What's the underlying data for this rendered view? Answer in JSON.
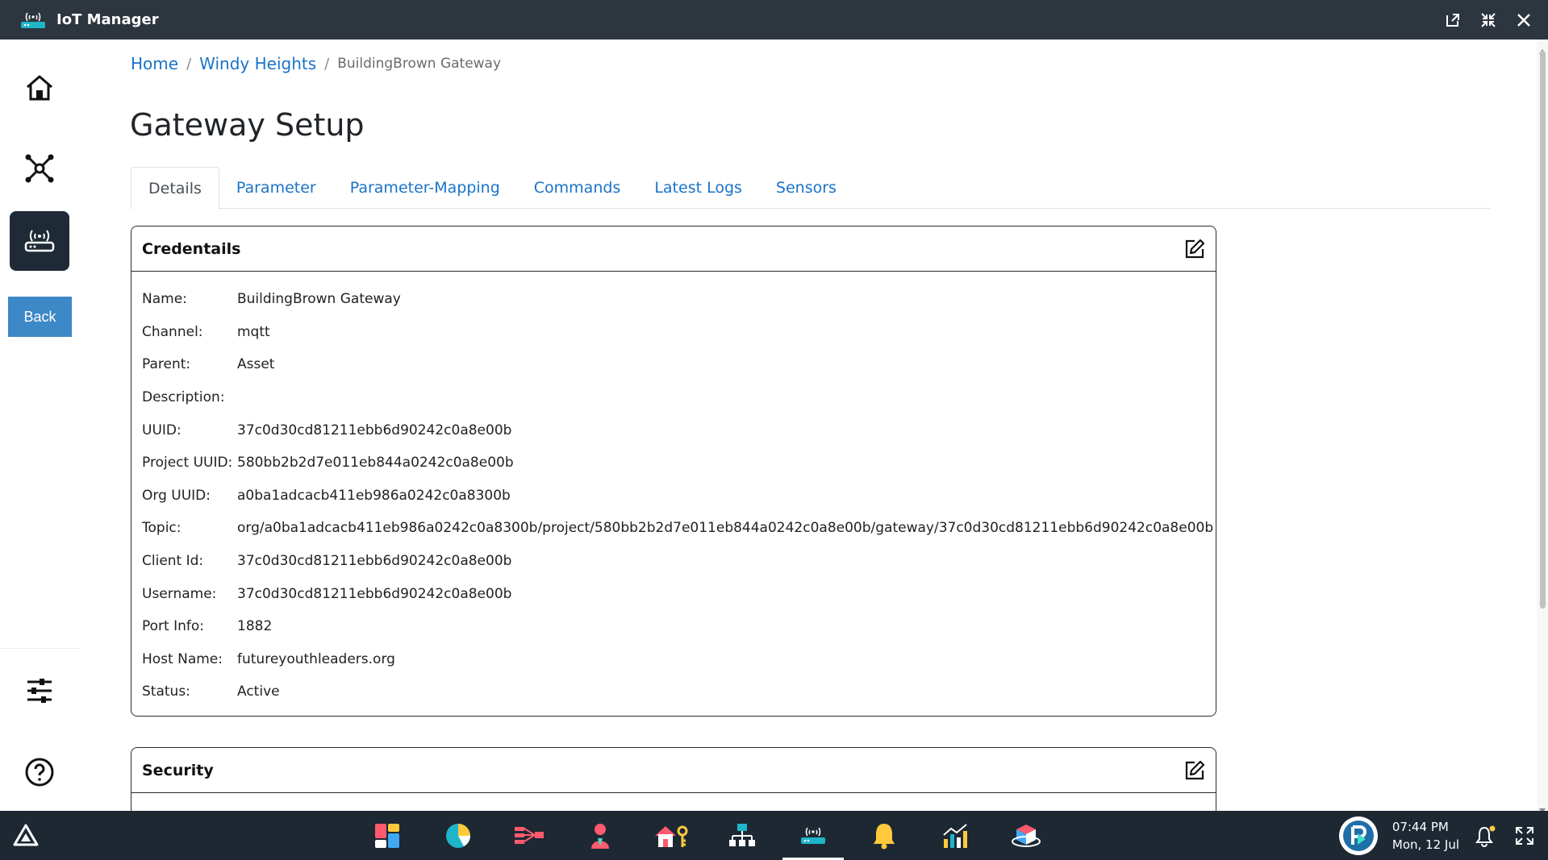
{
  "window": {
    "title": "IoT Manager",
    "controls": [
      "popout-icon",
      "shrink-icon",
      "close-icon"
    ]
  },
  "sidebar": {
    "items": [
      {
        "icon": "home-icon"
      },
      {
        "icon": "network-icon"
      },
      {
        "icon": "gateway-icon",
        "active": true
      }
    ],
    "back_label": "Back",
    "bottom_items": [
      {
        "icon": "sliders-icon"
      },
      {
        "icon": "help-icon"
      }
    ]
  },
  "breadcrumb": {
    "home": "Home",
    "site": "Windy Heights",
    "current": "BuildingBrown Gateway",
    "separator": "/"
  },
  "page_title": "Gateway Setup",
  "tabs": [
    {
      "label": "Details",
      "active": true
    },
    {
      "label": "Parameter"
    },
    {
      "label": "Parameter-Mapping"
    },
    {
      "label": "Commands"
    },
    {
      "label": "Latest Logs"
    },
    {
      "label": "Sensors"
    }
  ],
  "credentials": {
    "title": "Credentails",
    "rows": [
      {
        "label": "Name:",
        "value": "BuildingBrown Gateway"
      },
      {
        "label": "Channel:",
        "value": "mqtt"
      },
      {
        "label": "Parent:",
        "value": "Asset"
      },
      {
        "label": "Description:",
        "value": ""
      },
      {
        "label": "UUID:",
        "value": "37c0d30cd81211ebb6d90242c0a8e00b"
      },
      {
        "label": "Project UUID:",
        "value": "580bb2b2d7e011eb844a0242c0a8e00b"
      },
      {
        "label": "Org UUID:",
        "value": "a0ba1adcacb411eb986a0242c0a8300b"
      },
      {
        "label": "Topic:",
        "value": "org/a0ba1adcacb411eb986a0242c0a8300b/project/580bb2b2d7e011eb844a0242c0a8e00b/gateway/37c0d30cd81211ebb6d90242c0a8e00b"
      },
      {
        "label": "Client Id:",
        "value": "37c0d30cd81211ebb6d90242c0a8e00b"
      },
      {
        "label": "Username:",
        "value": "37c0d30cd81211ebb6d90242c0a8e00b"
      },
      {
        "label": "Port Info:",
        "value": "1882"
      },
      {
        "label": "Host Name:",
        "value": "futureyouthleaders.org"
      },
      {
        "label": "Status:",
        "value": "Active"
      }
    ]
  },
  "security": {
    "title": "Security"
  },
  "taskbar": {
    "apps": [
      {
        "icon": "dashboard-app-icon"
      },
      {
        "icon": "analytics-pie-app-icon"
      },
      {
        "icon": "flow-app-icon"
      },
      {
        "icon": "user-app-icon"
      },
      {
        "icon": "property-access-app-icon"
      },
      {
        "icon": "hierarchy-app-icon"
      },
      {
        "icon": "gateway-app-icon",
        "active": true
      },
      {
        "icon": "alerts-app-icon"
      },
      {
        "icon": "reports-app-icon"
      },
      {
        "icon": "3d-model-app-icon"
      }
    ],
    "time": "07:44 PM",
    "date": "Mon, 12 Jul"
  },
  "colors": {
    "titlebar": "#2d353f",
    "taskbar": "#1d2833",
    "link": "#1a73c9",
    "back_button": "#3d88c6",
    "active_sidebar": "#1e2a36"
  }
}
